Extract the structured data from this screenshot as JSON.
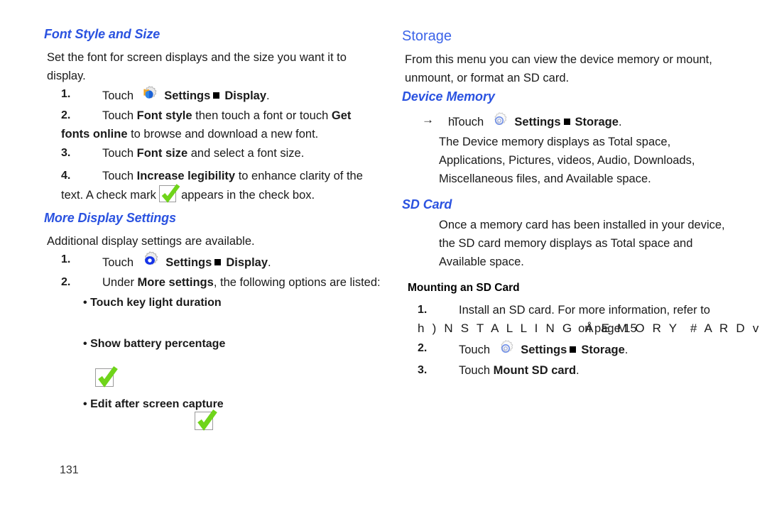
{
  "document": {
    "page_number": "131",
    "accent_heading_color": "#2a52e0",
    "check_color": "#6fd41a"
  },
  "left_column": {
    "heading_font_style": "Font Style and Size",
    "intro": "Set the font for screen displays and the size you want it to display.",
    "steps_font": [
      {
        "num": "1.",
        "pre": "Touch",
        "icon": "settings-gear-icon",
        "label1": "Settings",
        "sep": "square-bullet",
        "label2": "Display",
        "post": "."
      },
      {
        "num": "2.",
        "text_a": "Touch ",
        "bold_a": "Font style",
        "text_b": " then touch a font or touch ",
        "bold_b": "Get fonts online",
        "text_c": " to browse and download a new font."
      },
      {
        "num": "3.",
        "text_a": "Touch ",
        "bold_a": "Font size",
        "text_b": " and select a font size."
      },
      {
        "num": "4.",
        "text_a": "Touch ",
        "bold_a": "Increase legibility",
        "text_b": " to enhance clarity of the text. A check mark ",
        "icon": "green-checkmark-icon",
        "text_c": " appears in the check box."
      }
    ],
    "heading_more_display": "More Display Settings",
    "more_intro": "Additional display settings are available.",
    "steps_more": [
      {
        "num": "1.",
        "pre": "Touch",
        "icon": "settings-gear-icon",
        "label1": "Settings",
        "sep": "square-bullet",
        "label2": "Display",
        "post": "."
      },
      {
        "num": "2.",
        "text_a": "Under ",
        "bold_a": "More settings",
        "text_b": ", the following options are listed:"
      }
    ],
    "options": [
      "Touch key light duration",
      "Show battery percentage",
      "Edit after screen capture"
    ]
  },
  "right_column": {
    "heading_storage": "Storage",
    "storage_intro": "From this menu you can view the device memory or mount, unmount, or format an SD card.",
    "heading_device_memory": "Device Memory",
    "device_memory_step": {
      "arrow": "→",
      "artifact_h": "h",
      "pre": "Touch",
      "icon": "settings-gear-icon",
      "label1": "Settings",
      "sep": "square-bullet",
      "label2": "Storage",
      "post": "."
    },
    "device_memory_body": "The Device memory displays as Total space, Applications, Pictures, videos, Audio, Downloads, Miscellaneous files, and Available space.",
    "heading_sd_card": "SD Card",
    "sd_card_body": "Once a memory card has been installed in your device, the SD card memory displays as Total space and Available space.",
    "heading_mounting": "Mounting an SD Card",
    "mounting_steps": [
      {
        "num": "1.",
        "text_a": "Install an SD card. For more information, refer to",
        "garbled_prefix": "h ) N S T A L L I N G  ",
        "overlap_text": "on page 15",
        "garbled_suffix": "Å E M O R Y  # A R D v"
      },
      {
        "num": "2.",
        "pre": "Touch",
        "icon": "settings-gear-icon",
        "label1": "Settings",
        "sep": "square-bullet",
        "label2": "Storage",
        "post": "."
      },
      {
        "num": "3.",
        "text_a": "Touch ",
        "bold_a": "Mount SD card",
        "text_b": "."
      }
    ]
  }
}
